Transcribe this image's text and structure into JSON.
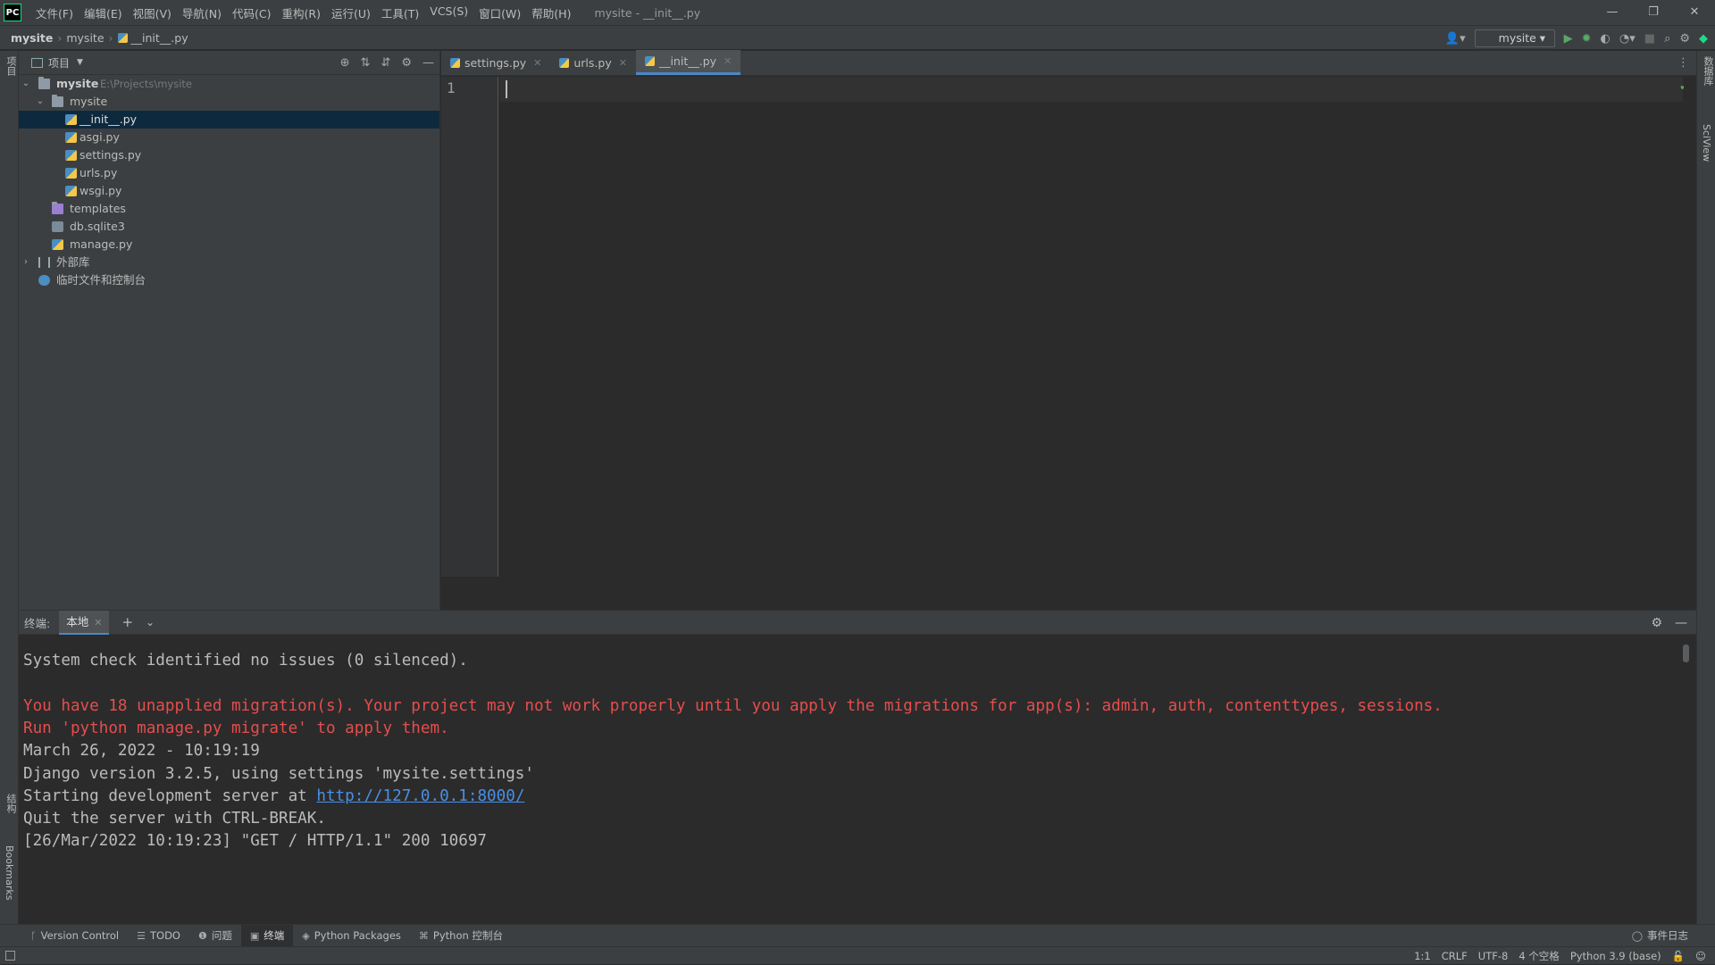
{
  "titlebar": {
    "logo": "PC",
    "menu": [
      "文件(F)",
      "编辑(E)",
      "视图(V)",
      "导航(N)",
      "代码(C)",
      "重构(R)",
      "运行(U)",
      "工具(T)",
      "VCS(S)",
      "窗口(W)",
      "帮助(H)"
    ],
    "window_title": "mysite - __init__.py"
  },
  "navbar": {
    "crumbs": [
      "mysite",
      "mysite",
      "__init__.py"
    ],
    "run_config": "mysite"
  },
  "left_strip": {
    "project_label": "项目",
    "structure_label": "结构",
    "bookmarks_label": "Bookmarks"
  },
  "right_strip": {
    "database_label": "数据库",
    "sciview_label": "SciView"
  },
  "project": {
    "title": "项目",
    "root_name": "mysite",
    "root_path": "E:\\Projects\\mysite",
    "pkg_name": "mysite",
    "files": [
      "__init__.py",
      "asgi.py",
      "settings.py",
      "urls.py",
      "wsgi.py"
    ],
    "templates": "templates",
    "db": "db.sqlite3",
    "manage": "manage.py",
    "external_libs": "外部库",
    "scratches": "临时文件和控制台"
  },
  "editor": {
    "tabs": [
      "settings.py",
      "urls.py",
      "__init__.py"
    ],
    "active_tab": 2,
    "line_number": "1"
  },
  "terminal": {
    "label": "终端:",
    "tab": "本地",
    "lines": [
      "System check identified no issues (0 silenced).",
      "",
      "You have 18 unapplied migration(s). Your project may not work properly until you apply the migrations for app(s): admin, auth, contenttypes, sessions.",
      "Run 'python manage.py migrate' to apply them.",
      "March 26, 2022 - 10:19:19",
      "Django version 3.2.5, using settings 'mysite.settings'",
      "Starting development server at ",
      "Quit the server with CTRL-BREAK.",
      "[26/Mar/2022 10:19:23] \"GET / HTTP/1.1\" 200 10697"
    ],
    "server_url": "http://127.0.0.1:8000/"
  },
  "toolwindows": {
    "items": [
      "Version Control",
      "TODO",
      "问题",
      "终端",
      "Python Packages",
      "Python 控制台"
    ],
    "event_log": "事件日志"
  },
  "status": {
    "position": "1:1",
    "line_sep": "CRLF",
    "encoding": "UTF-8",
    "indent": "4 个空格",
    "interpreter": "Python 3.9 (base)"
  },
  "colors": {
    "accent": "#4a88c7",
    "error_text": "#e64d4d",
    "link": "#4a8fe7",
    "run_green": "#59a869"
  }
}
